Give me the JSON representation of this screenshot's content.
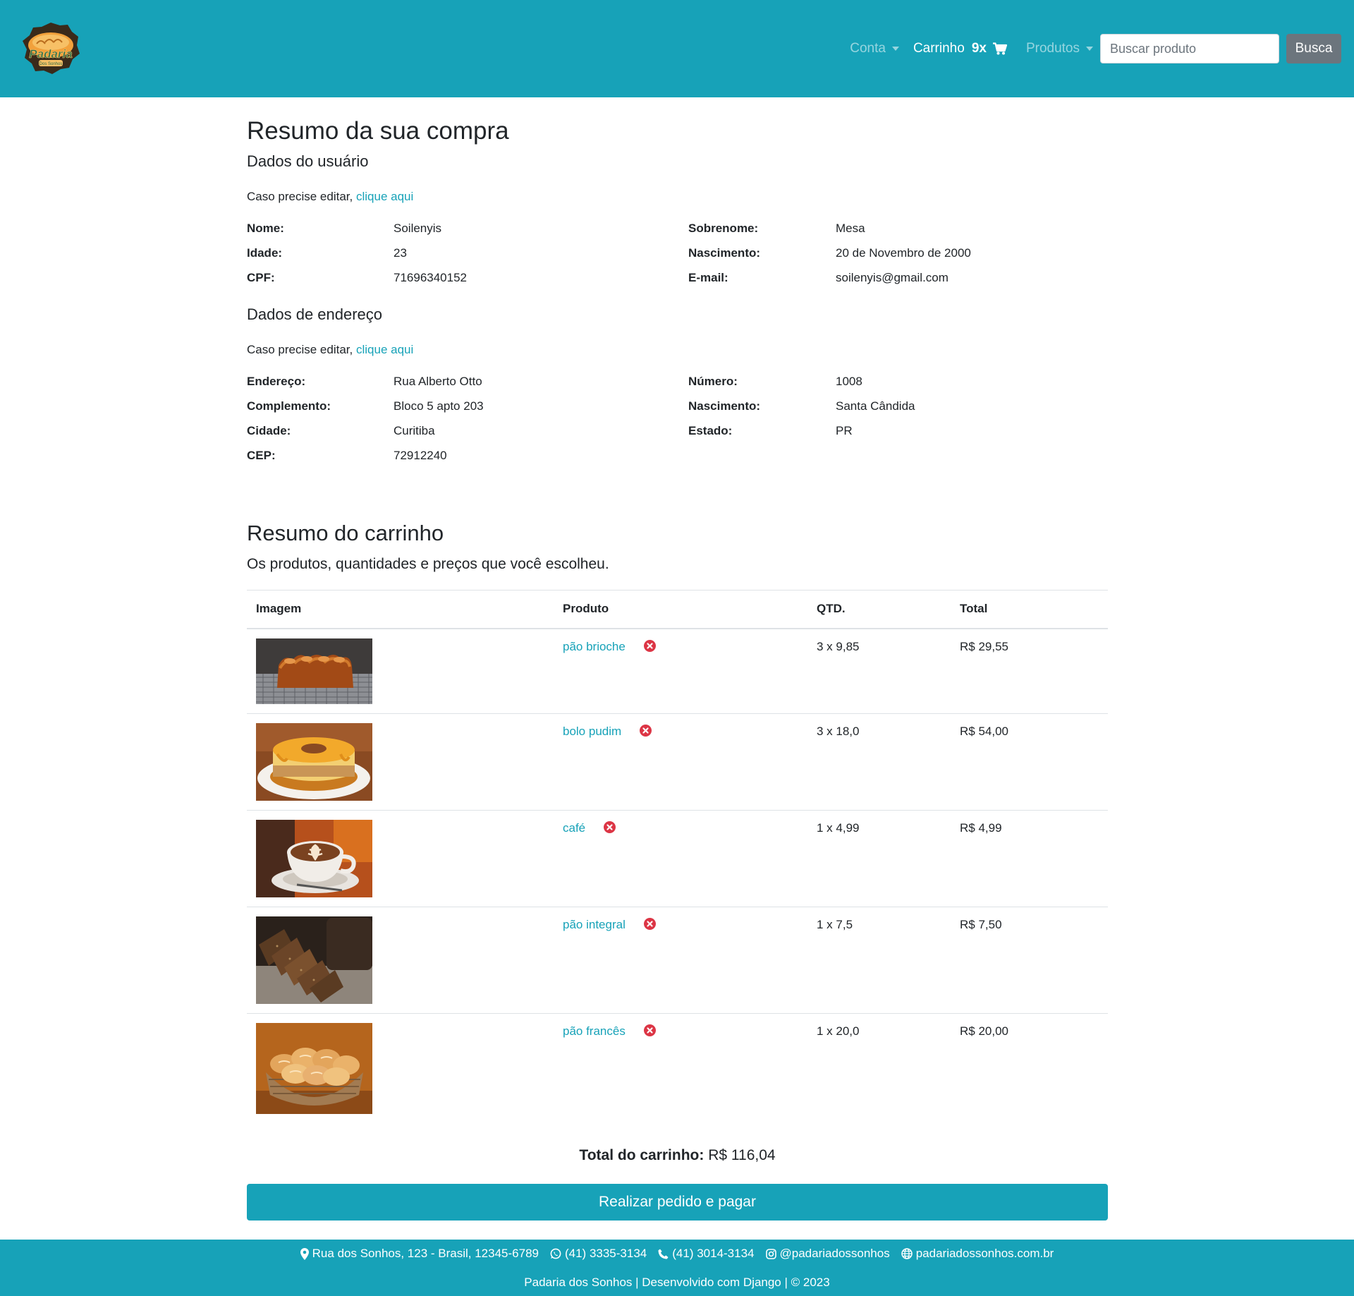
{
  "brand": {
    "logo_text": "Padaria",
    "logo_subtext": "Dos Sonhos",
    "colors": {
      "primary": "#17a2b8",
      "secondary_button": "#6c757d",
      "danger": "#dc3545"
    }
  },
  "nav": {
    "account_label": "Conta",
    "cart_label": "Carrinho",
    "cart_count": "9x",
    "products_label": "Produtos",
    "search_placeholder": "Buscar produto",
    "search_button": "Busca"
  },
  "summary": {
    "title": "Resumo da sua compra",
    "user_section": {
      "heading": "Dados do usuário",
      "edit_prefix": "Caso precise editar,",
      "edit_link": "clique aqui",
      "fields": [
        {
          "label": "Nome:",
          "value": "Soilenyis"
        },
        {
          "label": "Sobrenome:",
          "value": "Mesa"
        },
        {
          "label": "Idade:",
          "value": "23"
        },
        {
          "label": "Nascimento:",
          "value": "20 de Novembro de 2000"
        },
        {
          "label": "CPF:",
          "value": "71696340152"
        },
        {
          "label": "E-mail:",
          "value": "soilenyis@gmail.com"
        }
      ]
    },
    "address_section": {
      "heading": "Dados de endereço",
      "edit_prefix": "Caso precise editar,",
      "edit_link": "clique aqui",
      "fields": [
        {
          "label": "Endereço:",
          "value": "Rua Alberto Otto"
        },
        {
          "label": "Número:",
          "value": "1008"
        },
        {
          "label": "Complemento:",
          "value": "Bloco 5 apto 203"
        },
        {
          "label": "Nascimento:",
          "value": "Santa Cândida"
        },
        {
          "label": "Cidade:",
          "value": "Curitiba"
        },
        {
          "label": "Estado:",
          "value": "PR"
        },
        {
          "label": "CEP:",
          "value": "72912240"
        }
      ]
    }
  },
  "cart": {
    "title": "Resumo do carrinho",
    "subtitle": "Os produtos, quantidades e preços que você escolheu.",
    "columns": [
      "Imagem",
      "Produto",
      "QTD.",
      "Total"
    ],
    "items": [
      {
        "product": "pão brioche",
        "qty": "3 x 9,85",
        "total": "R$ 29,55",
        "image": "brioche-photo"
      },
      {
        "product": "bolo pudim",
        "qty": "3 x 18,0",
        "total": "R$ 54,00",
        "image": "bolo-pudim-photo"
      },
      {
        "product": "café",
        "qty": "1 x 4,99",
        "total": "R$ 4,99",
        "image": "cafe-latte-art-photo"
      },
      {
        "product": "pão integral",
        "qty": "1 x 7,5",
        "total": "R$ 7,50",
        "image": "pao-integral-photo"
      },
      {
        "product": "pão francês",
        "qty": "1 x 20,0",
        "total": "R$ 20,00",
        "image": "pao-frances-basket-photo"
      }
    ],
    "total_label": "Total do carrinho:",
    "total_value": "R$ 116,04",
    "checkout_button": "Realizar pedido e pagar"
  },
  "footer": {
    "address": "Rua dos Sonhos, 123 - Brasil, 12345-6789",
    "whatsapp": "(41) 3335-3134",
    "phone": "(41) 3014-3134",
    "instagram": "@padariadossonhos",
    "website": "padariadossonhos.com.br",
    "credit": "Padaria dos Sonhos | Desenvolvido com Django | © 2023",
    "icons": [
      "map-marker-icon",
      "whatsapp-icon",
      "phone-icon",
      "instagram-icon",
      "globe-icon"
    ]
  }
}
